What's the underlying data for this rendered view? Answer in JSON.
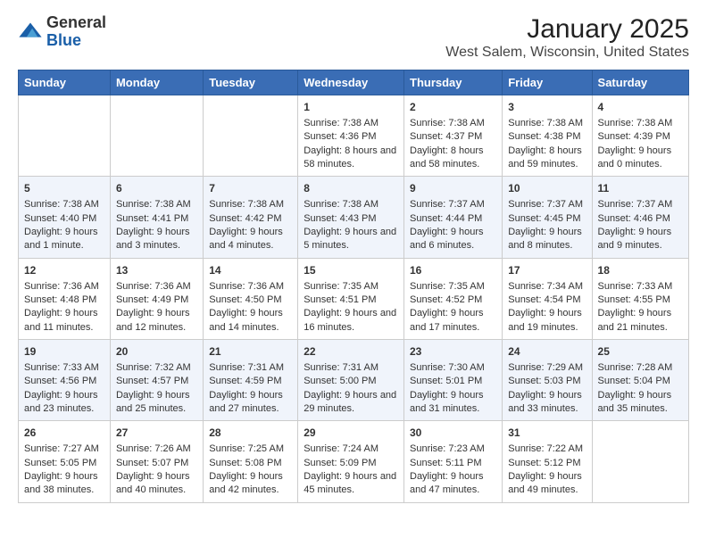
{
  "logo": {
    "general": "General",
    "blue": "Blue"
  },
  "title": "January 2025",
  "subtitle": "West Salem, Wisconsin, United States",
  "days": [
    "Sunday",
    "Monday",
    "Tuesday",
    "Wednesday",
    "Thursday",
    "Friday",
    "Saturday"
  ],
  "weeks": [
    [
      {
        "day": "",
        "content": ""
      },
      {
        "day": "",
        "content": ""
      },
      {
        "day": "",
        "content": ""
      },
      {
        "day": "1",
        "content": "Sunrise: 7:38 AM\nSunset: 4:36 PM\nDaylight: 8 hours and 58 minutes."
      },
      {
        "day": "2",
        "content": "Sunrise: 7:38 AM\nSunset: 4:37 PM\nDaylight: 8 hours and 58 minutes."
      },
      {
        "day": "3",
        "content": "Sunrise: 7:38 AM\nSunset: 4:38 PM\nDaylight: 8 hours and 59 minutes."
      },
      {
        "day": "4",
        "content": "Sunrise: 7:38 AM\nSunset: 4:39 PM\nDaylight: 9 hours and 0 minutes."
      }
    ],
    [
      {
        "day": "5",
        "content": "Sunrise: 7:38 AM\nSunset: 4:40 PM\nDaylight: 9 hours and 1 minute."
      },
      {
        "day": "6",
        "content": "Sunrise: 7:38 AM\nSunset: 4:41 PM\nDaylight: 9 hours and 3 minutes."
      },
      {
        "day": "7",
        "content": "Sunrise: 7:38 AM\nSunset: 4:42 PM\nDaylight: 9 hours and 4 minutes."
      },
      {
        "day": "8",
        "content": "Sunrise: 7:38 AM\nSunset: 4:43 PM\nDaylight: 9 hours and 5 minutes."
      },
      {
        "day": "9",
        "content": "Sunrise: 7:37 AM\nSunset: 4:44 PM\nDaylight: 9 hours and 6 minutes."
      },
      {
        "day": "10",
        "content": "Sunrise: 7:37 AM\nSunset: 4:45 PM\nDaylight: 9 hours and 8 minutes."
      },
      {
        "day": "11",
        "content": "Sunrise: 7:37 AM\nSunset: 4:46 PM\nDaylight: 9 hours and 9 minutes."
      }
    ],
    [
      {
        "day": "12",
        "content": "Sunrise: 7:36 AM\nSunset: 4:48 PM\nDaylight: 9 hours and 11 minutes."
      },
      {
        "day": "13",
        "content": "Sunrise: 7:36 AM\nSunset: 4:49 PM\nDaylight: 9 hours and 12 minutes."
      },
      {
        "day": "14",
        "content": "Sunrise: 7:36 AM\nSunset: 4:50 PM\nDaylight: 9 hours and 14 minutes."
      },
      {
        "day": "15",
        "content": "Sunrise: 7:35 AM\nSunset: 4:51 PM\nDaylight: 9 hours and 16 minutes."
      },
      {
        "day": "16",
        "content": "Sunrise: 7:35 AM\nSunset: 4:52 PM\nDaylight: 9 hours and 17 minutes."
      },
      {
        "day": "17",
        "content": "Sunrise: 7:34 AM\nSunset: 4:54 PM\nDaylight: 9 hours and 19 minutes."
      },
      {
        "day": "18",
        "content": "Sunrise: 7:33 AM\nSunset: 4:55 PM\nDaylight: 9 hours and 21 minutes."
      }
    ],
    [
      {
        "day": "19",
        "content": "Sunrise: 7:33 AM\nSunset: 4:56 PM\nDaylight: 9 hours and 23 minutes."
      },
      {
        "day": "20",
        "content": "Sunrise: 7:32 AM\nSunset: 4:57 PM\nDaylight: 9 hours and 25 minutes."
      },
      {
        "day": "21",
        "content": "Sunrise: 7:31 AM\nSunset: 4:59 PM\nDaylight: 9 hours and 27 minutes."
      },
      {
        "day": "22",
        "content": "Sunrise: 7:31 AM\nSunset: 5:00 PM\nDaylight: 9 hours and 29 minutes."
      },
      {
        "day": "23",
        "content": "Sunrise: 7:30 AM\nSunset: 5:01 PM\nDaylight: 9 hours and 31 minutes."
      },
      {
        "day": "24",
        "content": "Sunrise: 7:29 AM\nSunset: 5:03 PM\nDaylight: 9 hours and 33 minutes."
      },
      {
        "day": "25",
        "content": "Sunrise: 7:28 AM\nSunset: 5:04 PM\nDaylight: 9 hours and 35 minutes."
      }
    ],
    [
      {
        "day": "26",
        "content": "Sunrise: 7:27 AM\nSunset: 5:05 PM\nDaylight: 9 hours and 38 minutes."
      },
      {
        "day": "27",
        "content": "Sunrise: 7:26 AM\nSunset: 5:07 PM\nDaylight: 9 hours and 40 minutes."
      },
      {
        "day": "28",
        "content": "Sunrise: 7:25 AM\nSunset: 5:08 PM\nDaylight: 9 hours and 42 minutes."
      },
      {
        "day": "29",
        "content": "Sunrise: 7:24 AM\nSunset: 5:09 PM\nDaylight: 9 hours and 45 minutes."
      },
      {
        "day": "30",
        "content": "Sunrise: 7:23 AM\nSunset: 5:11 PM\nDaylight: 9 hours and 47 minutes."
      },
      {
        "day": "31",
        "content": "Sunrise: 7:22 AM\nSunset: 5:12 PM\nDaylight: 9 hours and 49 minutes."
      },
      {
        "day": "",
        "content": ""
      }
    ]
  ]
}
